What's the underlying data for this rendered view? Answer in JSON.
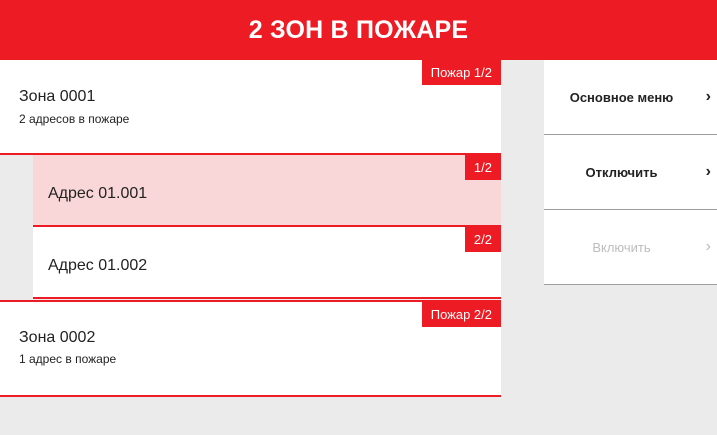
{
  "header": {
    "title": "2 ЗОН В ПОЖАРЕ"
  },
  "zones": [
    {
      "title": "Зона 0001",
      "subtitle": "2 адресов в пожаре",
      "badge": "Пожар 1/2",
      "addresses": [
        {
          "label": "Адрес 01.001",
          "badge": "1/2"
        },
        {
          "label": "Адрес 01.002",
          "badge": "2/2"
        }
      ]
    },
    {
      "title": "Зона 0002",
      "subtitle": "1 адрес в пожаре",
      "badge": "Пожар 2/2"
    }
  ],
  "menu": {
    "items": [
      {
        "label": "Основное меню",
        "chevron": "›",
        "enabled": true
      },
      {
        "label": "Отключить",
        "chevron": "›",
        "enabled": true
      },
      {
        "label": "Включить",
        "chevron": "›",
        "enabled": false
      }
    ]
  },
  "colors": {
    "accent": "#ed1c24",
    "selected_row": "#f9d7d8",
    "background": "#ebebeb"
  }
}
